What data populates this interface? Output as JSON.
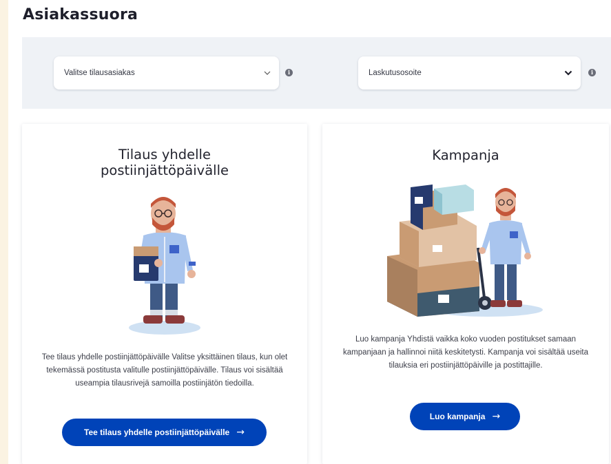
{
  "page": {
    "title": "Asiakassuora"
  },
  "filters": {
    "customer_select": {
      "value": "Valitse tilausasiakas",
      "icon": "chevron-down-icon"
    },
    "billing_select": {
      "value": "Laskutusosoite",
      "icon": "chevron-down-icon"
    },
    "info_glyph": "i"
  },
  "cards": [
    {
      "title": "Tilaus yhdelle postiinjättöpäivälle",
      "description": "Tee tilaus yhdelle postiinjättöpäivälle Valitse yksittäinen tilaus, kun olet tekemässä postitusta valitulle postiinjättöpäivälle. Tilaus voi sisältää useampia tilausrivejä samoilla postiinjätön tiedoilla.",
      "button_label": "Tee tilaus yhdelle postiinjättöpäivälle"
    },
    {
      "title": "Kampanja",
      "description": "Luo kampanja Yhdistä vaikka koko vuoden postitukset samaan kampanjaan ja hallinnoi niitä keskitetysti. Kampanja voi sisältää useita tilauksia eri postiinjättöpäiville ja postittajille.",
      "button_label": "Luo kampanja"
    }
  ],
  "arrow_glyph": "→",
  "colors": {
    "primary": "#0043b8",
    "filter_bar": "#eff2f6",
    "page_bg": "#fbf3e2"
  }
}
